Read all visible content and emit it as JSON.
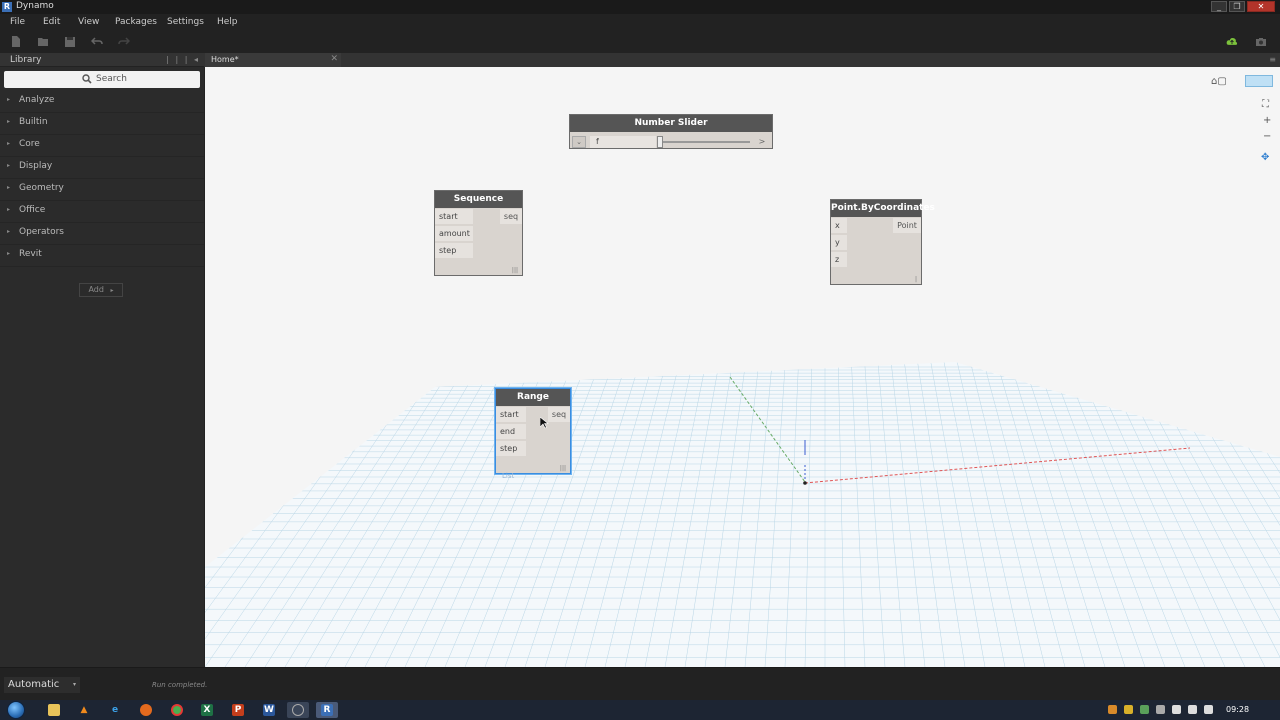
{
  "window": {
    "title": "Dynamo",
    "app_icon_letter": "R",
    "minimize": "_",
    "maximize": "❐",
    "close": "✕"
  },
  "menu": {
    "items": [
      "File",
      "Edit",
      "View",
      "Packages",
      "Settings",
      "Help"
    ]
  },
  "toolbar": {
    "icons": [
      "new-file-icon",
      "open-file-icon",
      "save-icon",
      "undo-icon",
      "redo-icon"
    ],
    "right_icons": [
      "cloud-icon",
      "camera-icon"
    ],
    "cloud_color": "#7cc23c"
  },
  "library": {
    "title": "Library",
    "search_placeholder": "Search",
    "items": [
      "Analyze",
      "Builtin",
      "Core",
      "Display",
      "Geometry",
      "Office",
      "Operators",
      "Revit"
    ],
    "add_label": "Add",
    "add_caret": "▸"
  },
  "tabs": [
    {
      "label": "Home*",
      "close": "✕"
    }
  ],
  "canvas": {
    "background": "#f5f5f5",
    "nodes": {
      "number_slider": {
        "title": "Number Slider",
        "value": "f",
        "output": ">",
        "toggle": "⌄"
      },
      "sequence": {
        "title": "Sequence",
        "inputs": [
          "start",
          "amount",
          "step"
        ],
        "output": "seq",
        "lacing": "|||"
      },
      "point_by_coordinates": {
        "title": "Point.ByCoordinates",
        "inputs": [
          "x",
          "y",
          "z"
        ],
        "output": "Point",
        "lacing": "|"
      },
      "range": {
        "title": "Range",
        "inputs": [
          "start",
          "end",
          "step"
        ],
        "output": "seq",
        "lacing": "|||",
        "preview": "List"
      }
    },
    "view_controls": [
      "zoom-fit-icon",
      "zoom-in-icon",
      "zoom-out-icon",
      "pan-icon"
    ],
    "view_toggle_icons": [
      "geometry-view-icon",
      "graph-view-icon"
    ]
  },
  "status": {
    "run_mode": "Automatic",
    "run_mode_caret": "▾",
    "message": "Run completed."
  },
  "taskbar": {
    "apps": [
      "explorer",
      "vlc",
      "ie",
      "firefox",
      "chrome",
      "excel",
      "powerpoint",
      "word",
      "dynamo",
      "revit"
    ],
    "clock": "09:28"
  }
}
